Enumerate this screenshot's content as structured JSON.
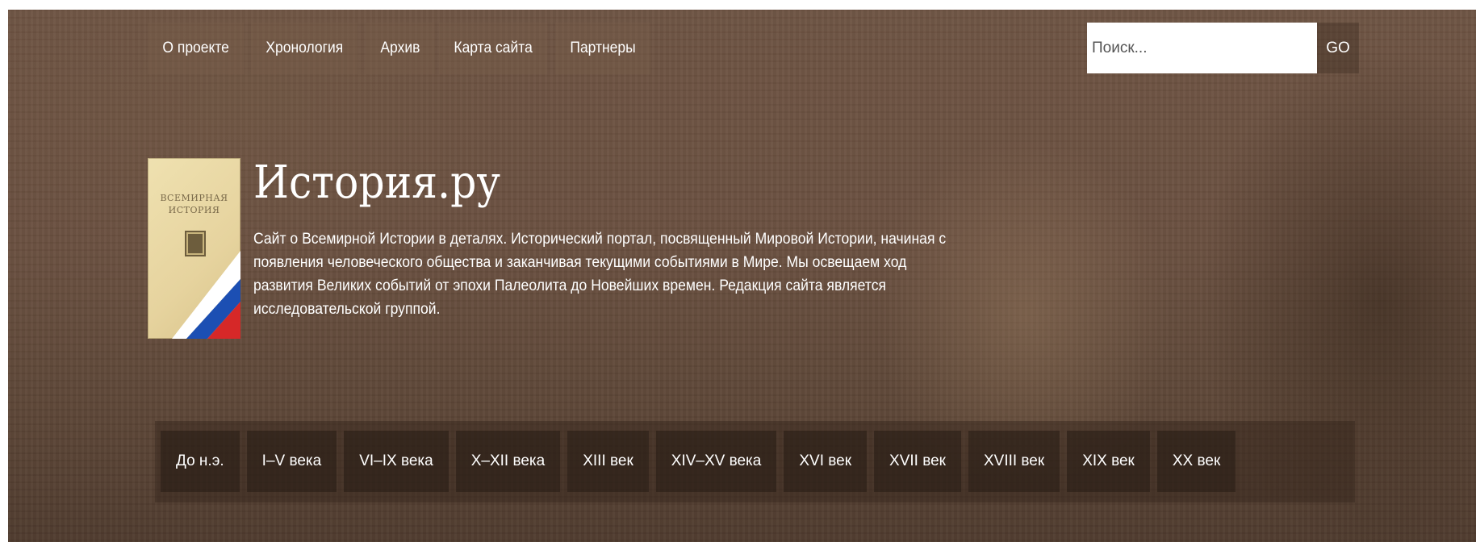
{
  "top_nav": {
    "items": [
      {
        "label": "О проекте"
      },
      {
        "label": "Хронология"
      },
      {
        "label": "Архив"
      },
      {
        "label": "Карта сайта"
      },
      {
        "label": "Партнеры"
      }
    ]
  },
  "search": {
    "placeholder": "Поиск...",
    "button_label": "GO"
  },
  "logo": {
    "book_title_line1": "ВСЕМИРНАЯ",
    "book_title_line2": "ИСТОРИЯ",
    "flag_colors": [
      "#ffffff",
      "#1c4fb3",
      "#d62828"
    ]
  },
  "header": {
    "title": "История.ру",
    "description": "Сайт о Всемирной Истории в деталях. Исторический портал, посвященный Мировой Истории, начиная с появления человеческого общества и заканчивая текущими событиями в Мире. Мы освещаем ход развития Великих событий от эпохи Палеолита до Новейших времен. Редакция сайта является исследовательской группой."
  },
  "period_nav": {
    "items": [
      {
        "label": "До н.э."
      },
      {
        "label": "I–V века"
      },
      {
        "label": "VI–IX века"
      },
      {
        "label": "X–XII века"
      },
      {
        "label": "XIII век"
      },
      {
        "label": "XIV–XV века"
      },
      {
        "label": "XVI век"
      },
      {
        "label": "XVII век"
      },
      {
        "label": "XVIII век"
      },
      {
        "label": "XIX век"
      },
      {
        "label": "XX век"
      }
    ]
  },
  "colors": {
    "background": "#6a5040",
    "text": "#ffffff",
    "nav_item_bg": "#2a1d15"
  }
}
